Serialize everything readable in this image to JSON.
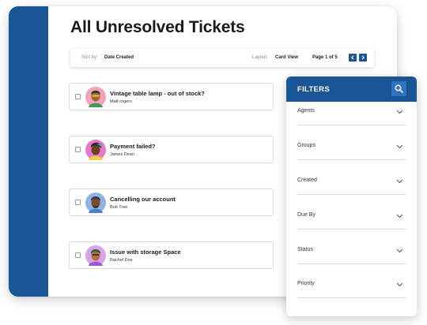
{
  "page": {
    "title": "All Unresolved Tickets"
  },
  "toolbar": {
    "sort_label": "Sort by:",
    "sort_value": "Date Created",
    "layout_label": "Layout:",
    "layout_value": "Card View",
    "page_info": "Page 1 of 5",
    "prev_icon": "chevron-left-icon",
    "next_icon": "chevron-right-icon"
  },
  "tickets": [
    {
      "title": "Vintage table lamp - out of stock?",
      "requester": "Matt rogers",
      "avatar_bg": "#f2a3b6"
    },
    {
      "title": "Payment failed?",
      "requester": "James Dean",
      "avatar_bg": "#e77ac9"
    },
    {
      "title": "Cancelling our account",
      "requester": "Bob Tree",
      "avatar_bg": "#8fb4e3"
    },
    {
      "title": "Issue with storage Space",
      "requester": "Rachel Doe",
      "avatar_bg": "#d9a3e8"
    }
  ],
  "filters": {
    "title": "FILTERS",
    "search_icon": "search-icon",
    "items": [
      {
        "label": "Agents"
      },
      {
        "label": "Groups"
      },
      {
        "label": "Created"
      },
      {
        "label": "Due By"
      },
      {
        "label": "Status"
      },
      {
        "label": "Priority"
      }
    ]
  },
  "colors": {
    "brand": "#1a5696",
    "accent": "#2f73bd"
  }
}
